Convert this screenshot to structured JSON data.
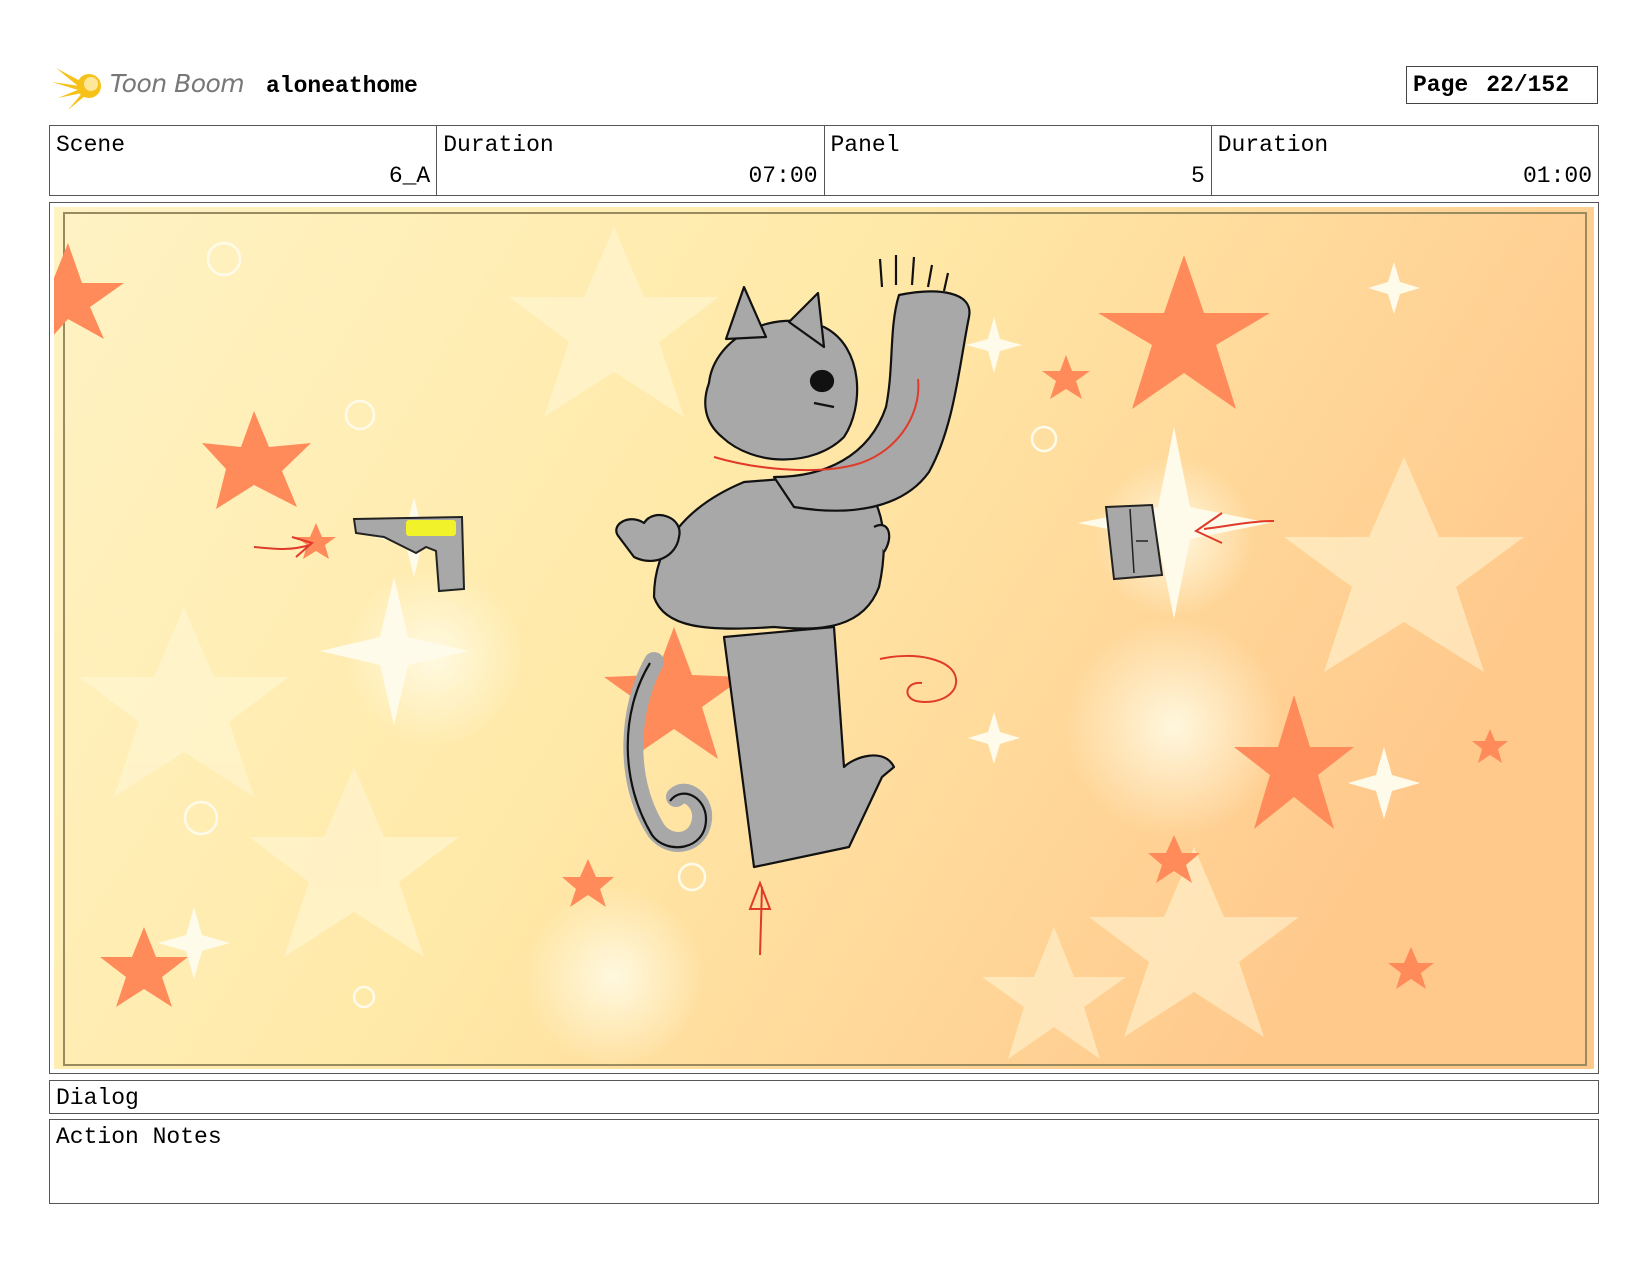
{
  "header": {
    "logo_text": "Toon Boom",
    "project_name": "aloneathome",
    "page_label": "Page",
    "page_value": "22/152"
  },
  "info": {
    "scene_label": "Scene",
    "scene_value": "6_A",
    "scene_duration_label": "Duration",
    "scene_duration_value": "07:00",
    "panel_label": "Panel",
    "panel_value": "5",
    "panel_duration_label": "Duration",
    "panel_duration_value": "01:00"
  },
  "panel": {
    "icons": [
      "star-icon",
      "sparkle-icon",
      "cat-character",
      "pistol-icon",
      "door-icon",
      "arrow-icon"
    ],
    "colors": {
      "background_light": "#fff1c0",
      "background_warm": "#ffd18a",
      "star": "#ff8a5a",
      "figure": "#a8a8a8",
      "note_ink": "#e03a2a",
      "highlight": "#f2f22a"
    }
  },
  "dialog_label": "Dialog",
  "notes_label": "Action Notes"
}
